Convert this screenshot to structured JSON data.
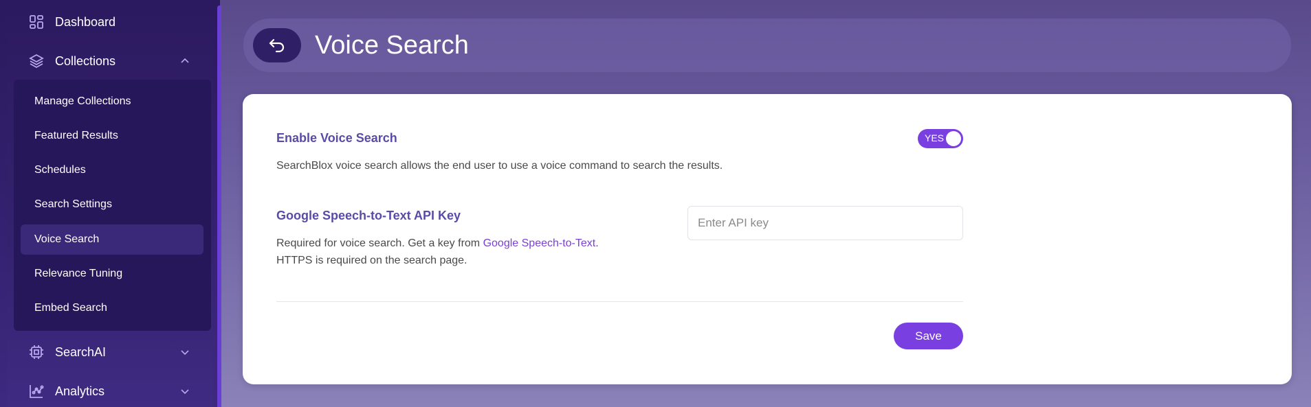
{
  "sidebar": {
    "dashboard_label": "Dashboard",
    "collections_label": "Collections",
    "submenu": [
      {
        "label": "Manage Collections"
      },
      {
        "label": "Featured Results"
      },
      {
        "label": "Schedules"
      },
      {
        "label": "Search Settings"
      },
      {
        "label": "Voice Search",
        "active": true
      },
      {
        "label": "Relevance Tuning"
      },
      {
        "label": "Embed Search"
      }
    ],
    "searchai_label": "SearchAI",
    "analytics_label": "Analytics"
  },
  "header": {
    "title": "Voice Search"
  },
  "card": {
    "enable_label": "Enable Voice Search",
    "toggle_text": "YES",
    "toggle_on": true,
    "enable_desc": "SearchBlox voice search allows the end user to use a voice command to search the results.",
    "api_label": "Google Speech-to-Text API Key",
    "api_desc_prefix": "Required for voice search. Get a key from ",
    "api_desc_link": "Google Speech-to-Text",
    "api_desc_suffix": ".",
    "api_desc_line2": "HTTPS is required on the search page.",
    "api_placeholder": "Enter API key",
    "api_value": "",
    "save_label": "Save"
  },
  "colors": {
    "accent": "#7a3fe0",
    "label": "#5b4aa6",
    "sidebar": "#2c1a60"
  }
}
